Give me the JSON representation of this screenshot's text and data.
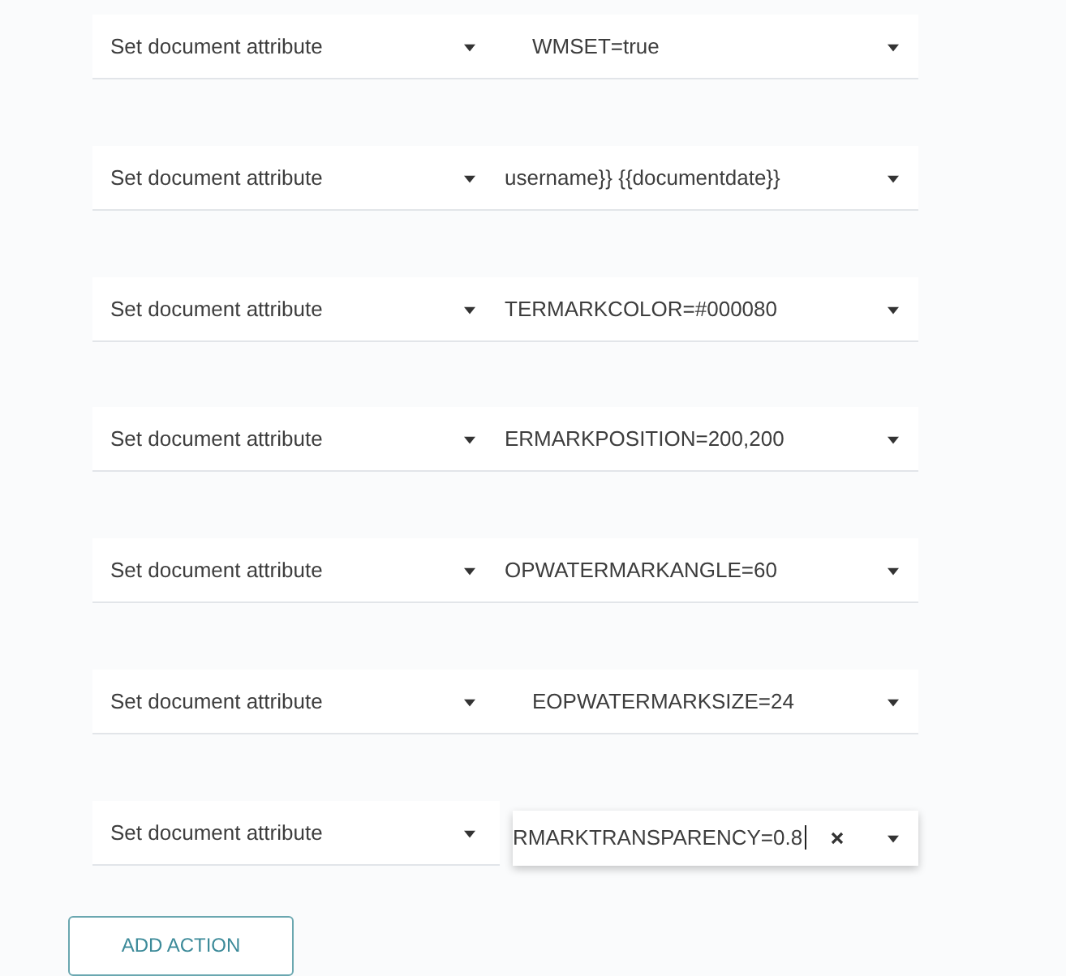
{
  "actions": [
    {
      "action_type": {
        "value": "Set document attribute"
      },
      "attribute": {
        "value": "WMSET=true",
        "scrolled": false,
        "focused": false
      }
    },
    {
      "action_type": {
        "value": "Set document attribute"
      },
      "attribute": {
        "value": "username}} {{documentdate}}",
        "scrolled": true,
        "focused": false
      }
    },
    {
      "action_type": {
        "value": "Set document attribute"
      },
      "attribute": {
        "value": "TERMARKCOLOR=#000080",
        "scrolled": true,
        "focused": false
      }
    },
    {
      "action_type": {
        "value": "Set document attribute"
      },
      "attribute": {
        "value": "ERMARKPOSITION=200,200",
        "scrolled": true,
        "focused": false
      }
    },
    {
      "action_type": {
        "value": "Set document attribute"
      },
      "attribute": {
        "value": "OPWATERMARKANGLE=60",
        "scrolled": true,
        "focused": false
      }
    },
    {
      "action_type": {
        "value": "Set document attribute"
      },
      "attribute": {
        "value": "EOPWATERMARKSIZE=24",
        "scrolled": false,
        "focused": false
      }
    },
    {
      "action_type": {
        "value": "Set document attribute"
      },
      "attribute": {
        "value": "RMARKTRANSPARENCY=0.8",
        "scrolled": true,
        "focused": true
      }
    }
  ],
  "add_button": {
    "label": "ADD ACTION"
  }
}
